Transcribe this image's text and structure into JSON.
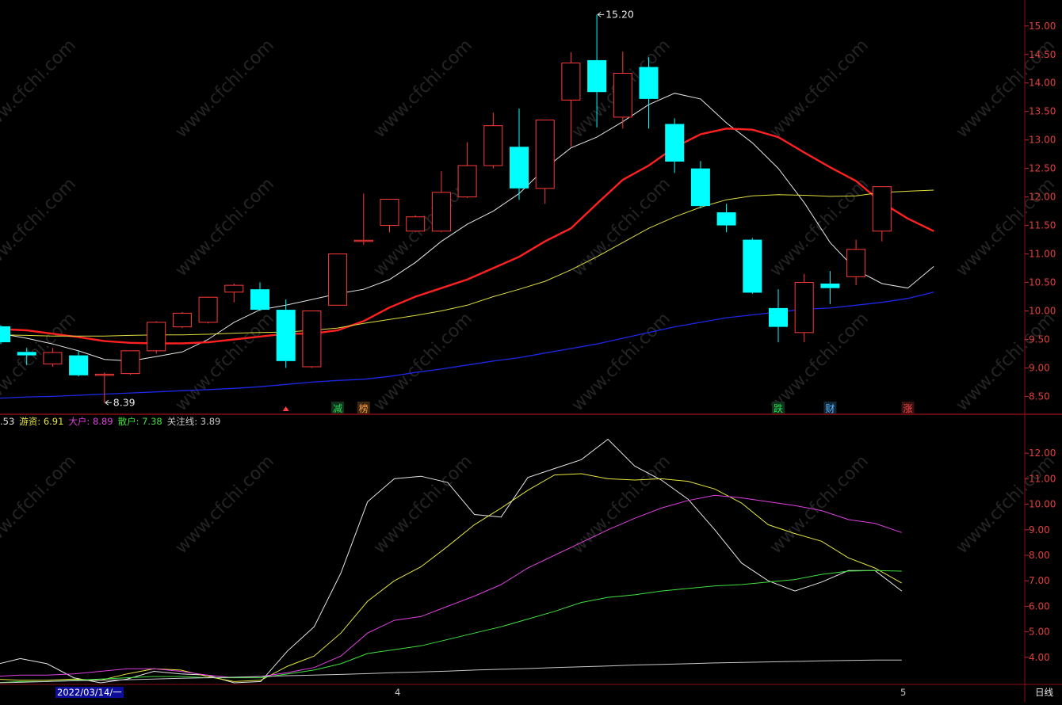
{
  "chart_data": [
    {
      "type": "candlestick",
      "period": "日线",
      "ylim": [
        8.2,
        15.4
      ],
      "y_ticks": [
        "8.50",
        "9.00",
        "9.50",
        "10.00",
        "10.50",
        "11.00",
        "11.50",
        "12.00",
        "12.50",
        "13.00",
        "13.50",
        "14.00",
        "14.50",
        "15.00"
      ],
      "candles": [
        {
          "o": 9.73,
          "h": 9.75,
          "l": 9.42,
          "c": 9.45
        },
        {
          "o": 9.28,
          "h": 9.35,
          "l": 9.05,
          "c": 9.22
        },
        {
          "o": 9.07,
          "h": 9.35,
          "l": 9.02,
          "c": 9.27
        },
        {
          "o": 9.22,
          "h": 9.3,
          "l": 8.85,
          "c": 8.87
        },
        {
          "o": 8.88,
          "h": 8.92,
          "l": 8.39,
          "c": 8.89
        },
        {
          "o": 8.9,
          "h": 9.3,
          "l": 8.88,
          "c": 9.3
        },
        {
          "o": 9.3,
          "h": 9.82,
          "l": 9.25,
          "c": 9.8
        },
        {
          "o": 9.72,
          "h": 9.98,
          "l": 9.7,
          "c": 9.96
        },
        {
          "o": 9.8,
          "h": 10.25,
          "l": 9.78,
          "c": 10.24
        },
        {
          "o": 10.33,
          "h": 10.48,
          "l": 10.15,
          "c": 10.45
        },
        {
          "o": 10.38,
          "h": 10.5,
          "l": 10.0,
          "c": 10.02
        },
        {
          "o": 10.02,
          "h": 10.2,
          "l": 9.0,
          "c": 9.12
        },
        {
          "o": 9.02,
          "h": 10.0,
          "l": 9.0,
          "c": 10.0
        },
        {
          "o": 10.1,
          "h": 11.0,
          "l": 10.1,
          "c": 11.0
        },
        {
          "o": 11.24,
          "h": 12.06,
          "l": 11.16,
          "c": 11.24
        },
        {
          "o": 11.5,
          "h": 11.9,
          "l": 11.38,
          "c": 11.96
        },
        {
          "o": 11.4,
          "h": 11.68,
          "l": 11.38,
          "c": 11.65
        },
        {
          "o": 11.4,
          "h": 12.45,
          "l": 11.38,
          "c": 12.08
        },
        {
          "o": 12.0,
          "h": 12.96,
          "l": 11.98,
          "c": 12.55
        },
        {
          "o": 12.55,
          "h": 13.48,
          "l": 12.5,
          "c": 13.25
        },
        {
          "o": 12.88,
          "h": 13.55,
          "l": 11.95,
          "c": 12.15
        },
        {
          "o": 12.15,
          "h": 13.35,
          "l": 11.88,
          "c": 13.35
        },
        {
          "o": 13.7,
          "h": 14.54,
          "l": 12.88,
          "c": 14.35
        },
        {
          "o": 14.4,
          "h": 15.2,
          "l": 13.22,
          "c": 13.84
        },
        {
          "o": 13.4,
          "h": 14.55,
          "l": 13.2,
          "c": 14.17
        },
        {
          "o": 14.28,
          "h": 14.45,
          "l": 13.2,
          "c": 13.72
        },
        {
          "o": 13.28,
          "h": 13.38,
          "l": 12.42,
          "c": 12.62
        },
        {
          "o": 12.5,
          "h": 12.63,
          "l": 11.8,
          "c": 11.84
        },
        {
          "o": 11.73,
          "h": 11.88,
          "l": 11.38,
          "c": 11.5
        },
        {
          "o": 11.25,
          "h": 11.28,
          "l": 10.3,
          "c": 10.32
        },
        {
          "o": 10.05,
          "h": 10.38,
          "l": 9.45,
          "c": 9.72
        },
        {
          "o": 9.62,
          "h": 10.65,
          "l": 9.45,
          "c": 10.5
        },
        {
          "o": 10.48,
          "h": 10.7,
          "l": 10.12,
          "c": 10.4
        },
        {
          "o": 10.6,
          "h": 11.25,
          "l": 10.45,
          "c": 11.08
        },
        {
          "o": 11.4,
          "h": 12.18,
          "l": 11.22,
          "c": 12.18
        }
      ],
      "ma_lines": [
        {
          "name": "ma_white",
          "color": "#e6e6e6",
          "width": 1,
          "start": 0,
          "values": [
            9.67,
            9.6,
            9.52,
            9.42,
            9.3,
            9.15,
            9.12,
            9.2,
            9.28,
            9.5,
            9.8,
            10.02,
            10.1,
            10.2,
            10.3,
            10.38,
            10.55,
            10.85,
            11.22,
            11.52,
            11.75,
            12.06,
            12.5,
            12.86,
            13.05,
            13.32,
            13.62,
            13.82,
            13.72,
            13.3,
            12.95,
            12.5,
            11.9,
            11.2,
            10.72,
            10.48,
            10.4,
            10.78
          ]
        },
        {
          "name": "ma_red",
          "color": "#ff2020",
          "width": 2.4,
          "start": 0,
          "values": [
            9.7,
            9.68,
            9.66,
            9.6,
            9.54,
            9.47,
            9.44,
            9.43,
            9.43,
            9.45,
            9.5,
            9.55,
            9.6,
            9.6,
            9.66,
            9.82,
            10.06,
            10.25,
            10.4,
            10.55,
            10.75,
            10.95,
            11.22,
            11.45,
            11.88,
            12.3,
            12.55,
            12.87,
            13.1,
            13.2,
            13.18,
            13.05,
            12.78,
            12.52,
            12.28,
            11.9,
            11.62,
            11.4
          ]
        },
        {
          "name": "ma_yellow",
          "color": "#dede40",
          "width": 1,
          "start": 0,
          "values": [
            9.6,
            9.58,
            9.57,
            9.56,
            9.56,
            9.56,
            9.57,
            9.58,
            9.58,
            9.59,
            9.61,
            9.62,
            9.63,
            9.66,
            9.7,
            9.78,
            9.85,
            9.92,
            10.0,
            10.1,
            10.25,
            10.38,
            10.52,
            10.72,
            10.95,
            11.2,
            11.45,
            11.65,
            11.82,
            11.95,
            12.02,
            12.04,
            12.03,
            12.01,
            12.02,
            12.08,
            12.1,
            12.12
          ]
        },
        {
          "name": "ma_blue",
          "color": "#1c28e6",
          "width": 1.3,
          "start": 0,
          "values": [
            8.45,
            8.47,
            8.49,
            8.5,
            8.52,
            8.54,
            8.56,
            8.58,
            8.6,
            8.62,
            8.64,
            8.67,
            8.71,
            8.75,
            8.78,
            8.8,
            8.85,
            8.92,
            8.98,
            9.05,
            9.12,
            9.18,
            9.26,
            9.34,
            9.42,
            9.52,
            9.62,
            9.72,
            9.8,
            9.88,
            9.93,
            9.98,
            10.03,
            10.05,
            10.1,
            10.15,
            10.22,
            10.33
          ]
        }
      ],
      "annotations": [
        {
          "text": "15.20",
          "candle": 23,
          "price": 15.2,
          "side": "right"
        },
        {
          "text": "8.39",
          "candle": 4,
          "price": 8.39,
          "side": "right"
        }
      ],
      "event_markers": [
        {
          "text": "减",
          "candle": 13,
          "color": "#22dd55",
          "bg": "#12321c"
        },
        {
          "text": "榜",
          "candle": 14,
          "color": "#ff9b40",
          "bg": "#3a2810"
        },
        {
          "text": "跌",
          "candle": 30,
          "color": "#22dd55",
          "bg": "#12321c"
        },
        {
          "text": "财",
          "candle": 32,
          "color": "#5fb4ff",
          "bg": "#102838"
        },
        {
          "text": "涨",
          "candle": 35,
          "color": "#ff4848",
          "bg": "#3a1212"
        }
      ],
      "small_marker": {
        "candle": 11,
        "color": "#ff4040"
      }
    },
    {
      "type": "line",
      "ylim": [
        3.0,
        13.0
      ],
      "y_ticks": [
        "4.00",
        "5.00",
        "6.00",
        "7.00",
        "8.00",
        "9.00",
        "10.00",
        "11.00",
        "12.00"
      ],
      "legend": [
        {
          "label": ".53",
          "value": "",
          "color": "#e6e6e6"
        },
        {
          "label": "游资: ",
          "value": "6.91",
          "color": "#e6e640"
        },
        {
          "label": "大户: ",
          "value": "8.89",
          "color": "#e040e0"
        },
        {
          "label": "散户: ",
          "value": "7.38",
          "color": "#40e040"
        },
        {
          "label": "关注线: ",
          "value": "3.89",
          "color": "#c8c8c8"
        }
      ],
      "series": [
        {
          "key": "main",
          "color": "#e6e6e6",
          "values": [
            3.7,
            3.95,
            3.75,
            3.2,
            3.0,
            3.15,
            3.45,
            3.35,
            3.3,
            3.0,
            3.05,
            4.25,
            5.2,
            7.3,
            10.1,
            11.0,
            11.1,
            10.85,
            9.6,
            9.5,
            11.05,
            11.4,
            11.75,
            12.55,
            11.5,
            10.95,
            10.2,
            9.0,
            7.7,
            7.0,
            6.6,
            6.95,
            7.4,
            7.4,
            6.6
          ]
        },
        {
          "key": "youzi",
          "color": "#e6e640",
          "values": [
            3.15,
            3.1,
            3.1,
            3.15,
            3.1,
            3.35,
            3.55,
            3.5,
            3.25,
            3.05,
            3.1,
            3.65,
            4.05,
            4.95,
            6.2,
            7.0,
            7.55,
            8.35,
            9.2,
            9.85,
            10.55,
            11.15,
            11.2,
            11.0,
            10.95,
            11.0,
            10.9,
            10.6,
            10.05,
            9.2,
            8.85,
            8.55,
            7.9,
            7.5,
            6.91
          ]
        },
        {
          "key": "dahu",
          "color": "#e040e0",
          "values": [
            3.25,
            3.3,
            3.3,
            3.35,
            3.45,
            3.55,
            3.55,
            3.45,
            3.3,
            3.2,
            3.25,
            3.4,
            3.6,
            4.05,
            4.95,
            5.45,
            5.6,
            6.0,
            6.4,
            6.85,
            7.5,
            8.0,
            8.5,
            9.0,
            9.45,
            9.85,
            10.15,
            10.35,
            10.25,
            10.1,
            9.95,
            9.75,
            9.4,
            9.25,
            8.89
          ]
        },
        {
          "key": "sanhu",
          "color": "#40e040",
          "values": [
            3.0,
            3.05,
            3.05,
            3.1,
            3.15,
            3.2,
            3.25,
            3.25,
            3.2,
            3.2,
            3.2,
            3.35,
            3.5,
            3.75,
            4.15,
            4.3,
            4.45,
            4.7,
            4.95,
            5.2,
            5.5,
            5.8,
            6.15,
            6.35,
            6.45,
            6.6,
            6.7,
            6.8,
            6.85,
            6.95,
            7.05,
            7.25,
            7.38,
            7.4,
            7.38
          ]
        },
        {
          "key": "guanzhu",
          "color": "#c8c8c8",
          "values": [
            3.0,
            3.02,
            3.05,
            3.08,
            3.1,
            3.12,
            3.15,
            3.18,
            3.2,
            3.22,
            3.25,
            3.28,
            3.3,
            3.33,
            3.36,
            3.4,
            3.43,
            3.46,
            3.5,
            3.53,
            3.56,
            3.6,
            3.63,
            3.66,
            3.7,
            3.72,
            3.75,
            3.78,
            3.8,
            3.82,
            3.84,
            3.86,
            3.88,
            3.89,
            3.89
          ]
        }
      ]
    }
  ],
  "x_axis": {
    "date_label": "2022/03/14/一",
    "month_labels": [
      "4",
      "5"
    ],
    "period_label": "日线"
  },
  "watermark": "www.cfchi.com"
}
